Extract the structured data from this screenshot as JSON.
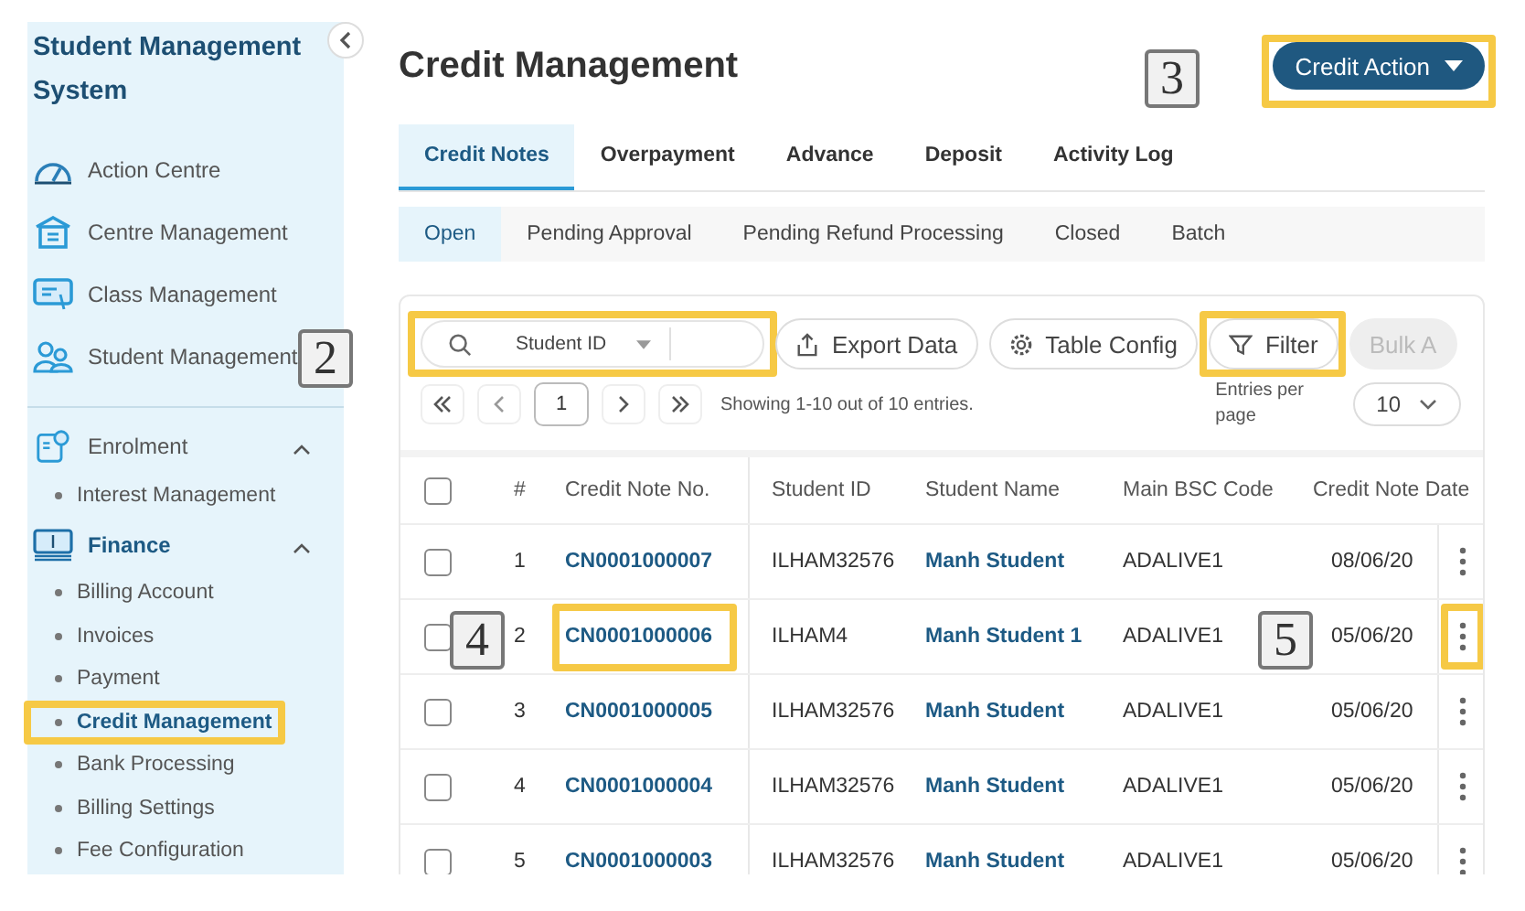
{
  "sidebar": {
    "title": "Student Management System",
    "items": [
      {
        "label": "Action Centre"
      },
      {
        "label": "Centre Management"
      },
      {
        "label": "Class Management"
      },
      {
        "label": "Student Management",
        "callout": "2"
      }
    ],
    "groups": [
      {
        "label": "Enrolment",
        "selected": false,
        "expanded": true,
        "children": [
          {
            "label": "Interest Management",
            "selected": false,
            "highlighted": false
          }
        ]
      },
      {
        "label": "Finance",
        "selected": true,
        "expanded": true,
        "children": [
          {
            "label": "Billing Account",
            "selected": false,
            "highlighted": false
          },
          {
            "label": "Invoices",
            "selected": false,
            "highlighted": false
          },
          {
            "label": "Payment",
            "selected": false,
            "highlighted": false
          },
          {
            "label": "Credit Management",
            "selected": true,
            "highlighted": true
          },
          {
            "label": "Bank Processing",
            "selected": false,
            "highlighted": false
          },
          {
            "label": "Billing Settings",
            "selected": false,
            "highlighted": false
          },
          {
            "label": "Fee Configuration",
            "selected": false,
            "highlighted": false
          }
        ]
      }
    ]
  },
  "page_title": "Credit Management",
  "credit_action": {
    "label": "Credit Action",
    "highlighted": true,
    "callout": "3"
  },
  "tabs": [
    {
      "label": "Credit Notes",
      "selected": true
    },
    {
      "label": "Overpayment",
      "selected": false
    },
    {
      "label": "Advance",
      "selected": false
    },
    {
      "label": "Deposit",
      "selected": false
    },
    {
      "label": "Activity Log",
      "selected": false
    }
  ],
  "subtabs": [
    {
      "label": "Open",
      "selected": true
    },
    {
      "label": "Pending Approval",
      "selected": false
    },
    {
      "label": "Pending Refund Processing",
      "selected": false
    },
    {
      "label": "Closed",
      "selected": false
    },
    {
      "label": "Batch",
      "selected": false
    }
  ],
  "search": {
    "field": "Student ID",
    "highlighted": true
  },
  "buttons": [
    {
      "kind": "export",
      "label": "Export Data",
      "disabled": false,
      "highlighted": false
    },
    {
      "kind": "config",
      "label": "Table Config",
      "disabled": false,
      "highlighted": false
    },
    {
      "kind": "filter",
      "label": "Filter",
      "disabled": false,
      "highlighted": true
    },
    {
      "kind": "bulk",
      "label": "Bulk A",
      "disabled": true,
      "highlighted": false
    }
  ],
  "pagination": {
    "page": "1",
    "summary": "Showing 1-10 out of 10 entries.",
    "entries_label": "Entries per page",
    "entries_value": "10"
  },
  "table": {
    "columns": [
      "#",
      "Credit Note No.",
      "Student ID",
      "Student Name",
      "Main BSC Code",
      "Credit Note Date"
    ],
    "header_checked": false,
    "rows": [
      {
        "checked": false,
        "number": "1",
        "credit_note_no": "CN0001000007",
        "student_id": "ILHAM32576",
        "student_name": "Manh Student",
        "bsc_code": "ADALIVE1",
        "date": "08/06/20",
        "note_highlighted": false,
        "menu_highlighted": false
      },
      {
        "checked": false,
        "number": "2",
        "credit_note_no": "CN0001000006",
        "student_id": "ILHAM4",
        "student_name": "Manh Student 1",
        "bsc_code": "ADALIVE1",
        "date": "05/06/20",
        "note_highlighted": true,
        "menu_highlighted": true,
        "checkbox_callout": "4",
        "date_callout": "5"
      },
      {
        "checked": false,
        "number": "3",
        "credit_note_no": "CN0001000005",
        "student_id": "ILHAM32576",
        "student_name": "Manh Student",
        "bsc_code": "ADALIVE1",
        "date": "05/06/20",
        "note_highlighted": false,
        "menu_highlighted": false
      },
      {
        "checked": false,
        "number": "4",
        "credit_note_no": "CN0001000004",
        "student_id": "ILHAM32576",
        "student_name": "Manh Student",
        "bsc_code": "ADALIVE1",
        "date": "05/06/20",
        "note_highlighted": false,
        "menu_highlighted": false
      },
      {
        "checked": false,
        "number": "5",
        "credit_note_no": "CN0001000003",
        "student_id": "ILHAM32576",
        "student_name": "Manh Student",
        "bsc_code": "ADALIVE1",
        "date": "05/06/20",
        "note_highlighted": false,
        "menu_highlighted": false
      }
    ]
  }
}
